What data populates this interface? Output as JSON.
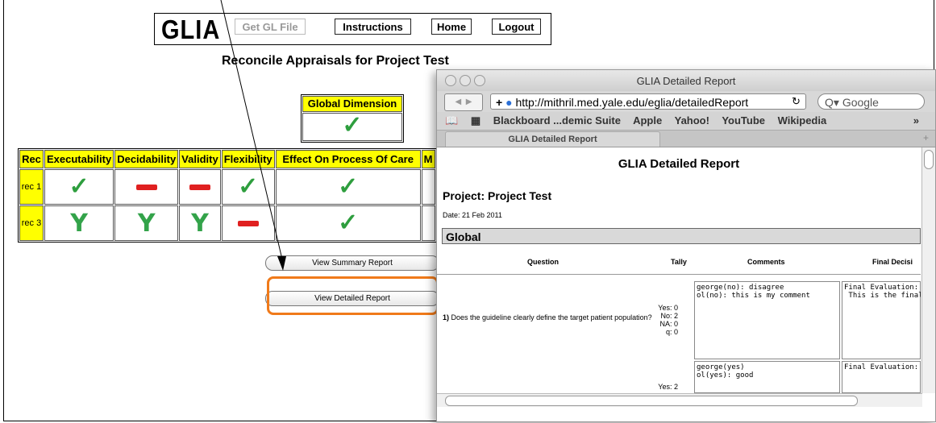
{
  "nav": {
    "logo": "GLIA",
    "get_file": "Get GL File",
    "instructions": "Instructions",
    "home": "Home",
    "logout": "Logout"
  },
  "page_title": "Reconcile Appraisals for Project Test",
  "global_dimension": {
    "header": "Global Dimension",
    "value_icon": "check-icon"
  },
  "table": {
    "headers": [
      "Rec",
      "Executability",
      "Decidability",
      "Validity",
      "Flexibility",
      "Effect On Process Of Care",
      "M"
    ],
    "rows": [
      {
        "rec": "rec 1",
        "cells": [
          "check",
          "dash",
          "dash",
          "check",
          "check",
          ""
        ]
      },
      {
        "rec": "rec 3",
        "cells": [
          "Y",
          "Y",
          "Y",
          "dash",
          "check",
          ""
        ]
      }
    ]
  },
  "buttons": {
    "summary": "View Summary Report",
    "detailed": "View Detailed Report"
  },
  "browser": {
    "window_title": "GLIA Detailed Report",
    "url": "http://mithril.med.yale.edu/eglia/detailedReport",
    "search_placeholder": "Google",
    "bookmarks": [
      "Blackboard ...demic Suite",
      "Apple",
      "Yahoo!",
      "YouTube",
      "Wikipedia"
    ],
    "tab_label": "GLIA Detailed Report"
  },
  "report": {
    "title": "GLIA Detailed Report",
    "project": "Project: Project Test",
    "date": "Date: 21 Feb 2011",
    "section": "Global",
    "columns": {
      "question": "Question",
      "tally": "Tally",
      "comments": "Comments",
      "final": "Final Decisi"
    },
    "question1": {
      "text_bold": "1)",
      "text": " Does the guideline clearly define the target patient population?",
      "tally": [
        "Yes: 0",
        "No: 2",
        "NA: 0",
        "q: 0"
      ],
      "comments": "george(no): disagree\nol(no): this is my comment",
      "final": "Final Evaluation: no\n This is the final..."
    },
    "question2": {
      "tally": [
        "Yes: 2"
      ],
      "comments": "george(yes)\nol(yes): good",
      "final": "Final Evaluation: no"
    }
  },
  "colors": {
    "accent_orange": "#f07a1a",
    "header_yellow": "#ffff00",
    "check_green": "#2e9e3e",
    "dash_red": "#e02020"
  }
}
